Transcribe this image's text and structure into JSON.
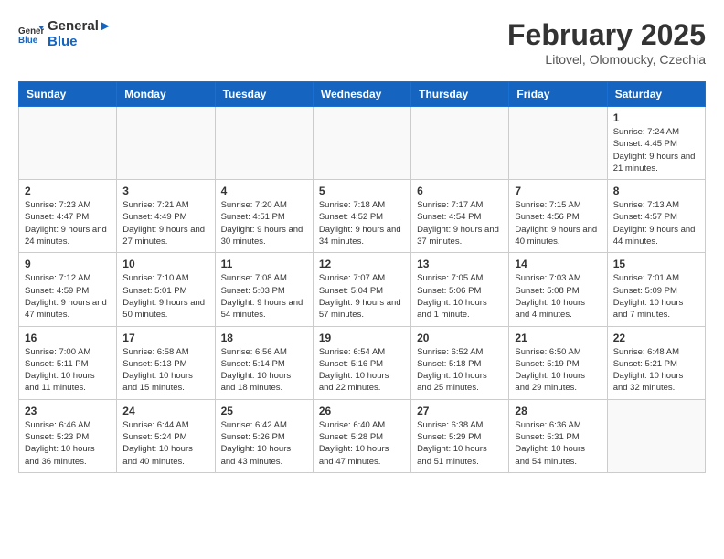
{
  "logo": {
    "line1": "General",
    "line2": "Blue"
  },
  "title": "February 2025",
  "subtitle": "Litovel, Olomoucky, Czechia",
  "days_of_week": [
    "Sunday",
    "Monday",
    "Tuesday",
    "Wednesday",
    "Thursday",
    "Friday",
    "Saturday"
  ],
  "weeks": [
    [
      {
        "day": "",
        "info": ""
      },
      {
        "day": "",
        "info": ""
      },
      {
        "day": "",
        "info": ""
      },
      {
        "day": "",
        "info": ""
      },
      {
        "day": "",
        "info": ""
      },
      {
        "day": "",
        "info": ""
      },
      {
        "day": "1",
        "info": "Sunrise: 7:24 AM\nSunset: 4:45 PM\nDaylight: 9 hours and 21 minutes."
      }
    ],
    [
      {
        "day": "2",
        "info": "Sunrise: 7:23 AM\nSunset: 4:47 PM\nDaylight: 9 hours and 24 minutes."
      },
      {
        "day": "3",
        "info": "Sunrise: 7:21 AM\nSunset: 4:49 PM\nDaylight: 9 hours and 27 minutes."
      },
      {
        "day": "4",
        "info": "Sunrise: 7:20 AM\nSunset: 4:51 PM\nDaylight: 9 hours and 30 minutes."
      },
      {
        "day": "5",
        "info": "Sunrise: 7:18 AM\nSunset: 4:52 PM\nDaylight: 9 hours and 34 minutes."
      },
      {
        "day": "6",
        "info": "Sunrise: 7:17 AM\nSunset: 4:54 PM\nDaylight: 9 hours and 37 minutes."
      },
      {
        "day": "7",
        "info": "Sunrise: 7:15 AM\nSunset: 4:56 PM\nDaylight: 9 hours and 40 minutes."
      },
      {
        "day": "8",
        "info": "Sunrise: 7:13 AM\nSunset: 4:57 PM\nDaylight: 9 hours and 44 minutes."
      }
    ],
    [
      {
        "day": "9",
        "info": "Sunrise: 7:12 AM\nSunset: 4:59 PM\nDaylight: 9 hours and 47 minutes."
      },
      {
        "day": "10",
        "info": "Sunrise: 7:10 AM\nSunset: 5:01 PM\nDaylight: 9 hours and 50 minutes."
      },
      {
        "day": "11",
        "info": "Sunrise: 7:08 AM\nSunset: 5:03 PM\nDaylight: 9 hours and 54 minutes."
      },
      {
        "day": "12",
        "info": "Sunrise: 7:07 AM\nSunset: 5:04 PM\nDaylight: 9 hours and 57 minutes."
      },
      {
        "day": "13",
        "info": "Sunrise: 7:05 AM\nSunset: 5:06 PM\nDaylight: 10 hours and 1 minute."
      },
      {
        "day": "14",
        "info": "Sunrise: 7:03 AM\nSunset: 5:08 PM\nDaylight: 10 hours and 4 minutes."
      },
      {
        "day": "15",
        "info": "Sunrise: 7:01 AM\nSunset: 5:09 PM\nDaylight: 10 hours and 7 minutes."
      }
    ],
    [
      {
        "day": "16",
        "info": "Sunrise: 7:00 AM\nSunset: 5:11 PM\nDaylight: 10 hours and 11 minutes."
      },
      {
        "day": "17",
        "info": "Sunrise: 6:58 AM\nSunset: 5:13 PM\nDaylight: 10 hours and 15 minutes."
      },
      {
        "day": "18",
        "info": "Sunrise: 6:56 AM\nSunset: 5:14 PM\nDaylight: 10 hours and 18 minutes."
      },
      {
        "day": "19",
        "info": "Sunrise: 6:54 AM\nSunset: 5:16 PM\nDaylight: 10 hours and 22 minutes."
      },
      {
        "day": "20",
        "info": "Sunrise: 6:52 AM\nSunset: 5:18 PM\nDaylight: 10 hours and 25 minutes."
      },
      {
        "day": "21",
        "info": "Sunrise: 6:50 AM\nSunset: 5:19 PM\nDaylight: 10 hours and 29 minutes."
      },
      {
        "day": "22",
        "info": "Sunrise: 6:48 AM\nSunset: 5:21 PM\nDaylight: 10 hours and 32 minutes."
      }
    ],
    [
      {
        "day": "23",
        "info": "Sunrise: 6:46 AM\nSunset: 5:23 PM\nDaylight: 10 hours and 36 minutes."
      },
      {
        "day": "24",
        "info": "Sunrise: 6:44 AM\nSunset: 5:24 PM\nDaylight: 10 hours and 40 minutes."
      },
      {
        "day": "25",
        "info": "Sunrise: 6:42 AM\nSunset: 5:26 PM\nDaylight: 10 hours and 43 minutes."
      },
      {
        "day": "26",
        "info": "Sunrise: 6:40 AM\nSunset: 5:28 PM\nDaylight: 10 hours and 47 minutes."
      },
      {
        "day": "27",
        "info": "Sunrise: 6:38 AM\nSunset: 5:29 PM\nDaylight: 10 hours and 51 minutes."
      },
      {
        "day": "28",
        "info": "Sunrise: 6:36 AM\nSunset: 5:31 PM\nDaylight: 10 hours and 54 minutes."
      },
      {
        "day": "",
        "info": ""
      }
    ]
  ]
}
